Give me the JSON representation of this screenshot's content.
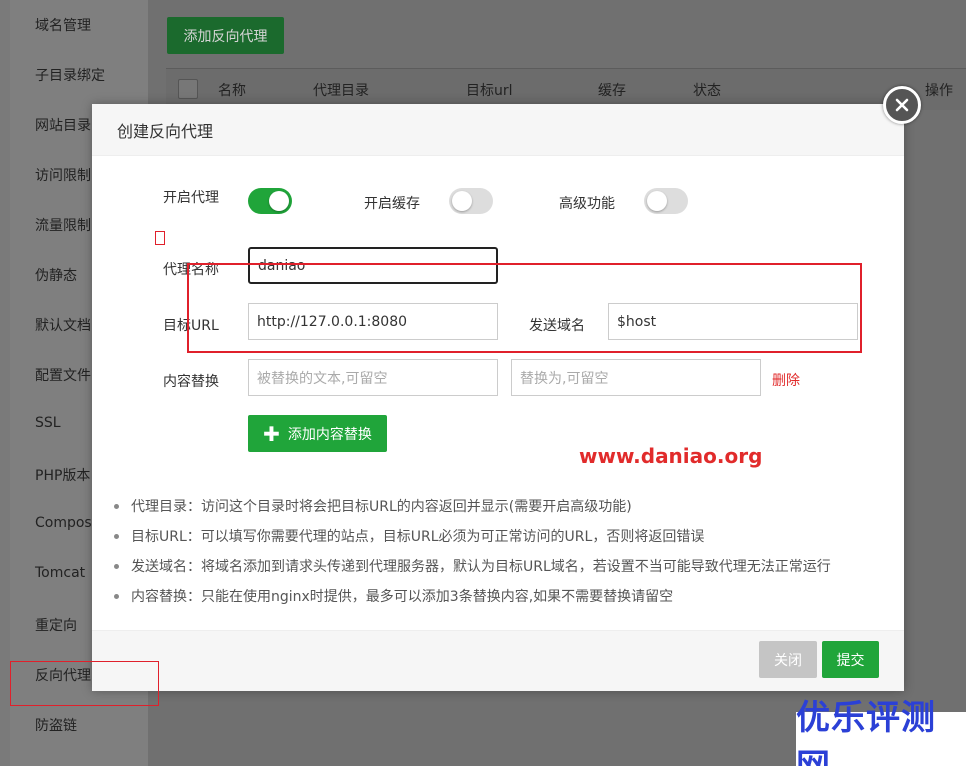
{
  "sidebar": {
    "items": [
      {
        "label": "域名管理"
      },
      {
        "label": "子目录绑定"
      },
      {
        "label": "网站目录"
      },
      {
        "label": "访问限制"
      },
      {
        "label": "流量限制"
      },
      {
        "label": "伪静态"
      },
      {
        "label": "默认文档"
      },
      {
        "label": "配置文件"
      },
      {
        "label": "SSL"
      },
      {
        "label": "PHP版本"
      },
      {
        "label": "Compos"
      },
      {
        "label": "Tomcat"
      },
      {
        "label": "重定向"
      },
      {
        "label": "反向代理"
      },
      {
        "label": "防盗链"
      }
    ]
  },
  "toolbar": {
    "add_proxy_label": "添加反向代理"
  },
  "table": {
    "columns": [
      "名称",
      "代理目录",
      "目标url",
      "缓存",
      "状态",
      "操作"
    ]
  },
  "modal": {
    "title": "创建反向代理",
    "toggles": {
      "enable_proxy": {
        "label": "开启代理",
        "on": true
      },
      "enable_cache": {
        "label": "开启缓存",
        "on": false
      },
      "advanced": {
        "label": "高级功能",
        "on": false
      }
    },
    "proxy_name": {
      "label": "代理名称",
      "value": "daniao"
    },
    "target_url": {
      "label": "目标URL",
      "value": "http://127.0.0.1:8080"
    },
    "send_domain": {
      "label": "发送域名",
      "value": "$host"
    },
    "content_replace": {
      "label": "内容替换",
      "from_placeholder": "被替换的文本,可留空",
      "to_placeholder": "替换为,可留空",
      "delete_label": "删除"
    },
    "add_content_label": "添加内容替换",
    "notes": [
      "代理目录：访问这个目录时将会把目标URL的内容返回并显示(需要开启高级功能)",
      "目标URL：可以填写你需要代理的站点，目标URL必须为可正常访问的URL，否则将返回错误",
      "发送域名：将域名添加到请求头传递到代理服务器，默认为目标URL域名，若设置不当可能导致代理无法正常运行",
      "内容替换：只能在使用nginx时提供，最多可以添加3条替换内容,如果不需要替换请留空"
    ],
    "close_label": "关闭",
    "submit_label": "提交"
  },
  "watermark": {
    "url": "www.daniao.org",
    "logo": "优乐评测网"
  },
  "colors": {
    "accent_green": "#20a53a",
    "danger_red": "#e12b2b",
    "annotation_red": "#e0202b",
    "logo_blue": "#2b40d6"
  }
}
